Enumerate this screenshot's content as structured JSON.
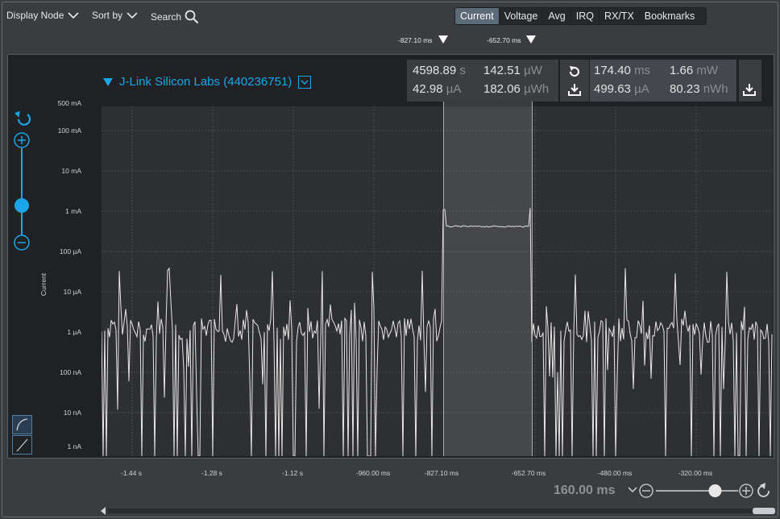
{
  "toolbar": {
    "display_node": "Display Node",
    "sort_by": "Sort by",
    "search": "Search"
  },
  "tabs": [
    "Current",
    "Voltage",
    "Avg",
    "IRQ",
    "RX/TX",
    "Bookmarks"
  ],
  "active_tab": "Current",
  "cursors": {
    "left": "-827.10 ms",
    "right": "-652.70 ms"
  },
  "device": {
    "name": "J-Link Silicon Labs (440236751)"
  },
  "stats": {
    "time": {
      "value": "4598.89",
      "unit": "s"
    },
    "power": {
      "value": "142.51",
      "unit": "µW"
    },
    "current": {
      "value": "42.98",
      "unit": "µA"
    },
    "energy": {
      "value": "182.06",
      "unit": "µWh"
    },
    "sel_duration": {
      "value": "174.40",
      "unit": "ms"
    },
    "sel_power": {
      "value": "1.66",
      "unit": "mW"
    },
    "sel_current": {
      "value": "499.63",
      "unit": "µA"
    },
    "sel_energy": {
      "value": "80.23",
      "unit": "nWh"
    }
  },
  "y_axis": {
    "title": "Current",
    "ticks": [
      "500 mA",
      "100 mA",
      "10 mA",
      "1 mA",
      "100 µA",
      "10 µA",
      "1 µA",
      "100 nA",
      "10 nA",
      "1 nA"
    ]
  },
  "x_axis": {
    "ticks": [
      "-1.44 s",
      "-1.28 s",
      "-1.12 s",
      "-960.00 ms",
      "-827.10 ms",
      "-652.70 ms",
      "-480.00 ms",
      "-320.00 ms"
    ]
  },
  "zoom": {
    "value": "160.00 ms",
    "slider_level": 0.72
  },
  "colors": {
    "accent": "#1aa6e8",
    "trace": "#e8e8e8",
    "plot_bg": "#2e2f32",
    "active_tab": "#5d6a78"
  },
  "chart_data": {
    "type": "line",
    "ylabel": "Current",
    "yscale": "log",
    "ylim_log10_A": [
      -9,
      -0.3
    ],
    "selection_level": "1 mA (≈ 0.5 mA plateau)",
    "baseline": "≈ 1 µA with spikes to ≈ 30 µA"
  }
}
